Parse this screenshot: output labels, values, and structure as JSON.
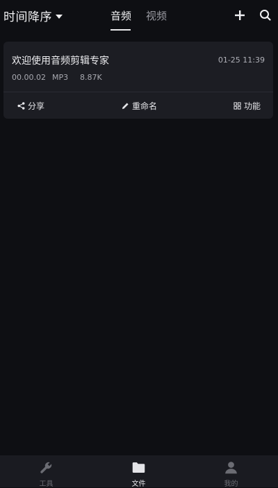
{
  "header": {
    "sort_label": "时间降序",
    "tabs": [
      {
        "label": "音频",
        "active": true
      },
      {
        "label": "视频",
        "active": false
      }
    ],
    "icons": {
      "add": "plus-icon",
      "search": "search-icon",
      "sort": "caret-down-icon"
    }
  },
  "files": [
    {
      "title": "欢迎使用音频剪辑专家",
      "date": "01-25 11:39",
      "duration": "00.00.02",
      "format": "MP3",
      "size": "8.87K",
      "actions": {
        "share": "分享",
        "rename": "重命名",
        "function": "功能"
      }
    }
  ],
  "bottom_nav": {
    "items": [
      {
        "label": "工具",
        "icon": "wrench-icon",
        "active": false
      },
      {
        "label": "文件",
        "icon": "folder-icon",
        "active": true
      },
      {
        "label": "我的",
        "icon": "user-icon",
        "active": false
      }
    ]
  },
  "colors": {
    "background": "#0e0f13",
    "card": "#1c1d23",
    "nav_bg": "#1a1b21",
    "active": "#e4e4e8",
    "inactive": "#6b6c73"
  }
}
